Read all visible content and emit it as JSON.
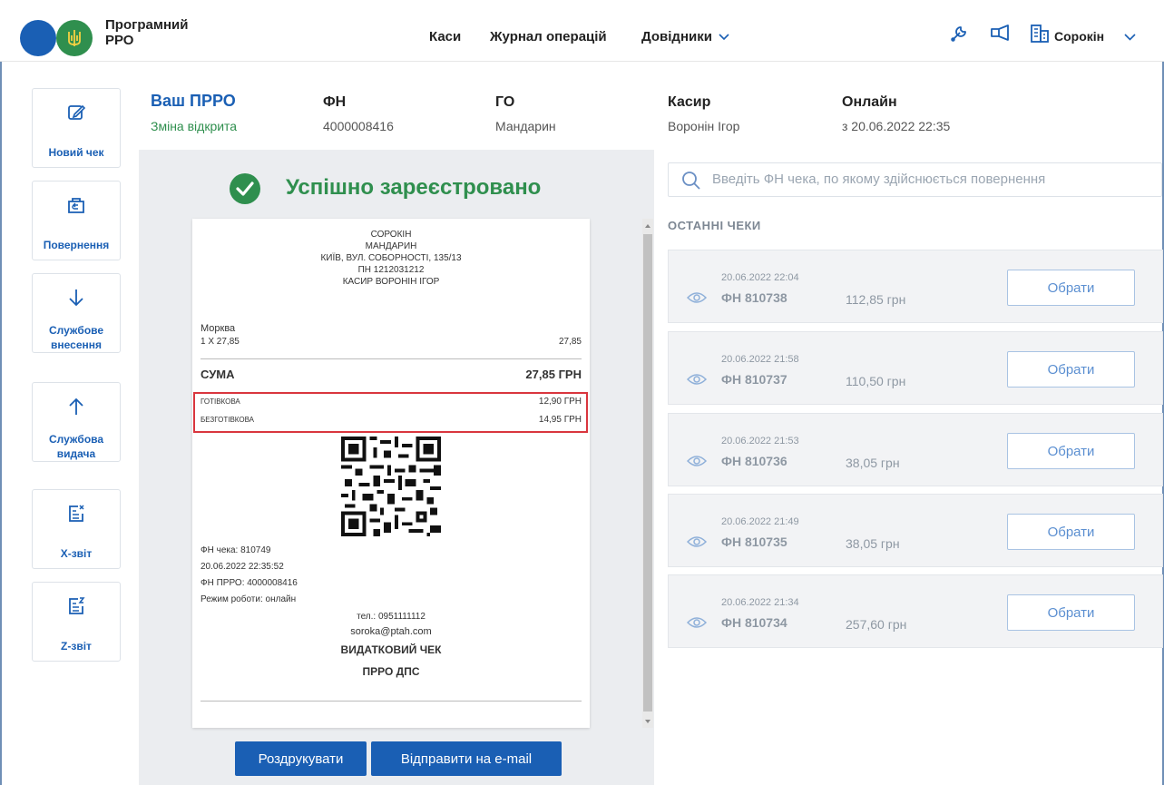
{
  "header": {
    "app_title_line1": "Програмний",
    "app_title_line2": "РРО",
    "nav": [
      "Каси",
      "Журнал операцій",
      "Довідники"
    ],
    "user": "Сорокін",
    "icons": [
      "wrench-icon",
      "megaphone-icon",
      "building-icon",
      "chevron-down-icon"
    ]
  },
  "sidebar": {
    "items": [
      {
        "label1": "Новий чек",
        "label2": "",
        "icon": "edit-icon"
      },
      {
        "label1": "Повернення",
        "label2": "",
        "icon": "return-icon"
      },
      {
        "label1": "Службове",
        "label2": "внесення",
        "icon": "arrow-down-icon"
      },
      {
        "label1": "Службова",
        "label2": "видача",
        "icon": "arrow-up-icon"
      },
      {
        "label1": "Х-звіт",
        "label2": "",
        "icon": "x-report-icon"
      },
      {
        "label1": "Z-звіт",
        "label2": "",
        "icon": "z-report-icon"
      }
    ]
  },
  "info": {
    "prro_title": "Ваш ПРРО",
    "prro_status": "Зміна відкрита",
    "fn_label": "ФН",
    "fn_value": "4000008416",
    "go_label": "ГО",
    "go_value": "Мандарин",
    "cashier_label": "Касир",
    "cashier_value": "Воронін Ігор",
    "online_label": "Онлайн",
    "online_value": "з 20.06.2022 22:35"
  },
  "success_text": "Успішно зареєстровано",
  "receipt": {
    "header_lines": [
      "СОРОКІН",
      "МАНДАРИН",
      "КИЇВ, ВУЛ. СОБОРНОСТІ, 135/13",
      "ПН 1212031212",
      "КАСИР ВОРОНІН ІГОР"
    ],
    "item_name": "Морква",
    "item_qty": "1 X 27,85",
    "item_total": "27,85",
    "sum_label": "СУМА",
    "sum_value": "27,85 ГРН",
    "cash_label": "ГОТІВКОВА",
    "cash_value": "12,90 ГРН",
    "card_label": "БЕЗГОТІВКОВА",
    "card_value": "14,95 ГРН",
    "fn_check": "ФН чека: 810749",
    "datetime": "20.06.2022 22:35:52",
    "fn_prro": "ФН ПРРО: 4000008416",
    "mode": "Режим роботи: онлайн",
    "phone": "тел.: 0951111112",
    "email": "soroka@ptah.com",
    "type": "ВИДАТКОВИЙ ЧЕК",
    "authority": "ПРРО ДПС"
  },
  "actions": {
    "print": "Роздрукувати",
    "email": "Відправити на e-mail"
  },
  "search": {
    "placeholder": "Введіть ФН чека, по якому здійснюється повернення"
  },
  "recent": {
    "title": "ОСТАННІ ЧЕКИ",
    "select_label": "Обрати",
    "items": [
      {
        "date": "20.06.2022 22:04",
        "fn": "ФН 810738",
        "amount": "112,85 грн"
      },
      {
        "date": "20.06.2022 21:58",
        "fn": "ФН 810737",
        "amount": "110,50 грн"
      },
      {
        "date": "20.06.2022 21:53",
        "fn": "ФН 810736",
        "amount": "38,05 грн"
      },
      {
        "date": "20.06.2022 21:49",
        "fn": "ФН 810735",
        "amount": "38,05 грн"
      },
      {
        "date": "20.06.2022 21:34",
        "fn": "ФН 810734",
        "amount": "257,60 грн"
      }
    ]
  },
  "colors": {
    "primary": "#1a5fb4",
    "success": "#2f8f4e",
    "highlight": "#d9363e"
  }
}
